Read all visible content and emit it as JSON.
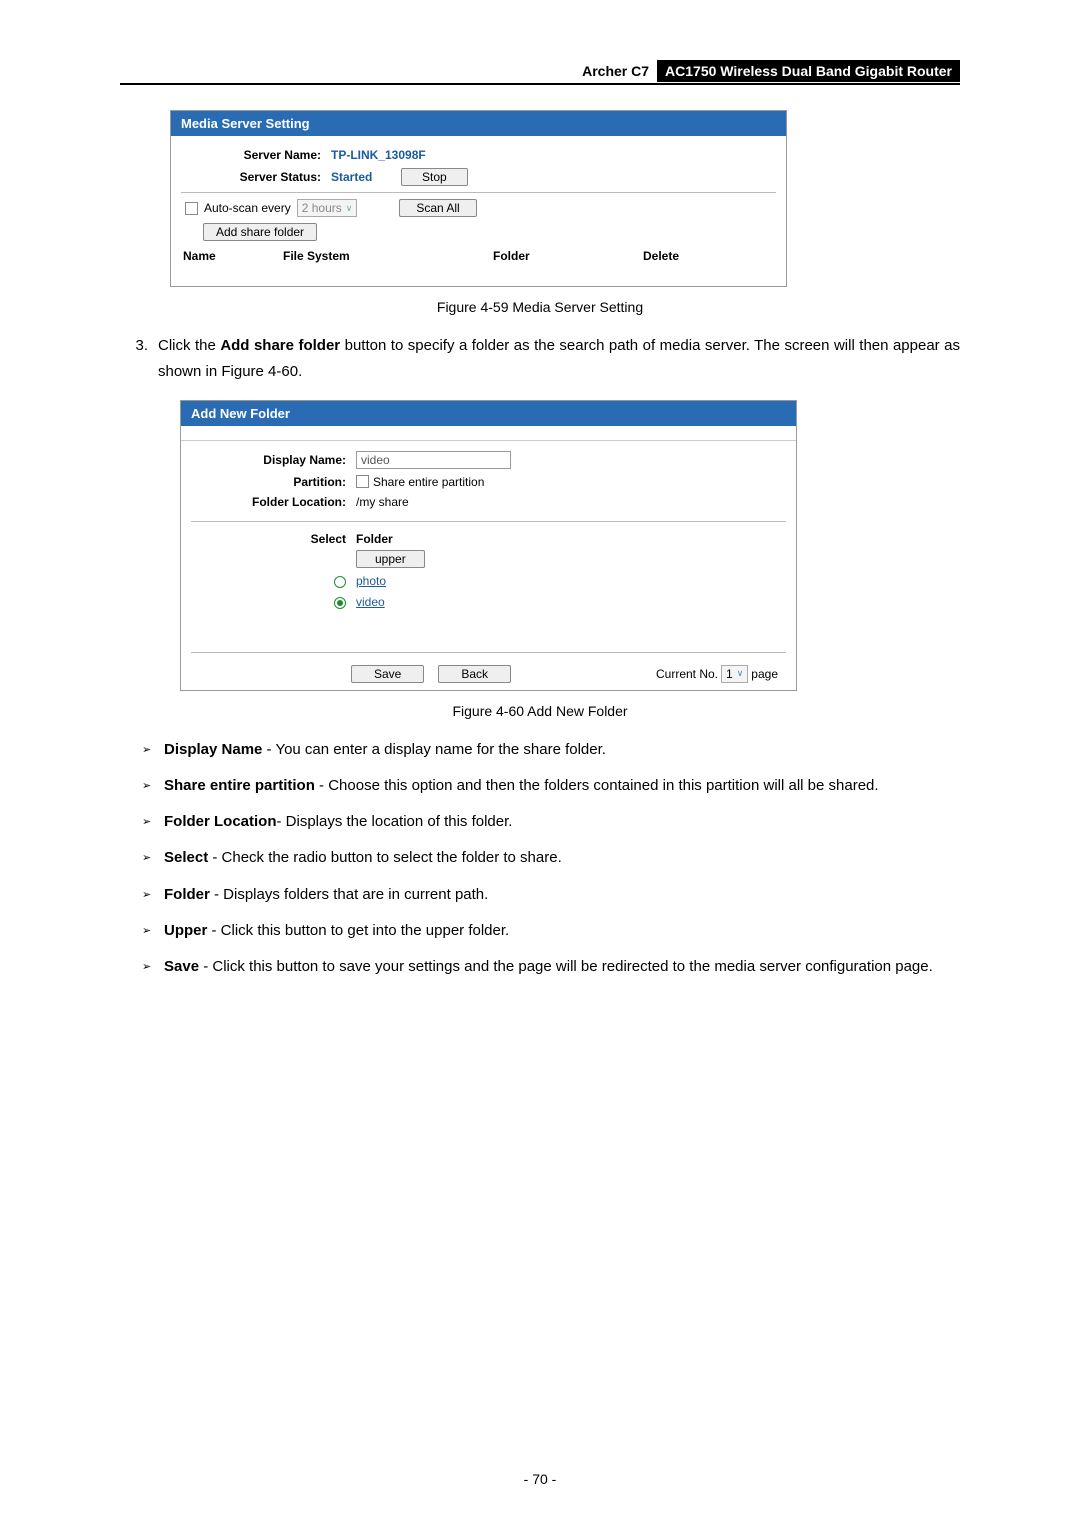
{
  "header": {
    "model": "Archer C7",
    "product": "AC1750 Wireless Dual Band Gigabit Router"
  },
  "panel1": {
    "title": "Media Server Setting",
    "server_name_lbl": "Server Name:",
    "server_name_val": "TP-LINK_13098F",
    "server_status_lbl": "Server Status:",
    "server_status_val": "Started",
    "stop_btn": "Stop",
    "autoscan_lbl": "Auto-scan every",
    "autoscan_val": "2 hours",
    "scan_all_btn": "Scan All",
    "add_share_btn": "Add share folder",
    "cols": {
      "name": "Name",
      "fs": "File System",
      "folder": "Folder",
      "delete": "Delete"
    }
  },
  "caption1": "Figure 4-59 Media Server Setting",
  "step3": {
    "num": "3.",
    "text_pre": "Click the ",
    "bold": "Add share folder",
    "text_post": " button to specify a folder as the search path of media server. The screen will then appear as shown in Figure 4-60."
  },
  "panel2": {
    "title": "Add New Folder",
    "display_name_lbl": "Display Name:",
    "display_name_val": "video",
    "partition_lbl": "Partition:",
    "share_entire_lbl": "Share entire partition",
    "folder_loc_lbl": "Folder Location:",
    "folder_loc_val": "/my share",
    "select_lbl": "Select",
    "folder_hdr": "Folder",
    "upper_btn": "upper",
    "folders": {
      "photo": "photo",
      "video": "video"
    },
    "save_btn": "Save",
    "back_btn": "Back",
    "current_lbl": "Current No.",
    "page_no": "1",
    "page_lbl": "page"
  },
  "caption2": "Figure 4-60 Add New Folder",
  "bullets": {
    "b1": {
      "bold": "Display Name",
      "text": " - You can enter a display name for the share folder."
    },
    "b2": {
      "bold": "Share entire partition",
      "text": " - Choose this option and then the folders contained in this partition will all be shared."
    },
    "b3": {
      "bold": "Folder Location",
      "text": "- Displays the location of this folder."
    },
    "b4": {
      "bold": "Select",
      "text": " - Check the radio button to select the folder to share."
    },
    "b5": {
      "bold": "Folder",
      "text": " - Displays folders that are in current path."
    },
    "b6": {
      "bold": "Upper",
      "text": " - Click this button to get into the upper folder."
    },
    "b7": {
      "bold": "Save",
      "text": " - Click this button to save your settings and the page will be redirected to the media server configuration page."
    }
  },
  "page_number": "- 70 -"
}
